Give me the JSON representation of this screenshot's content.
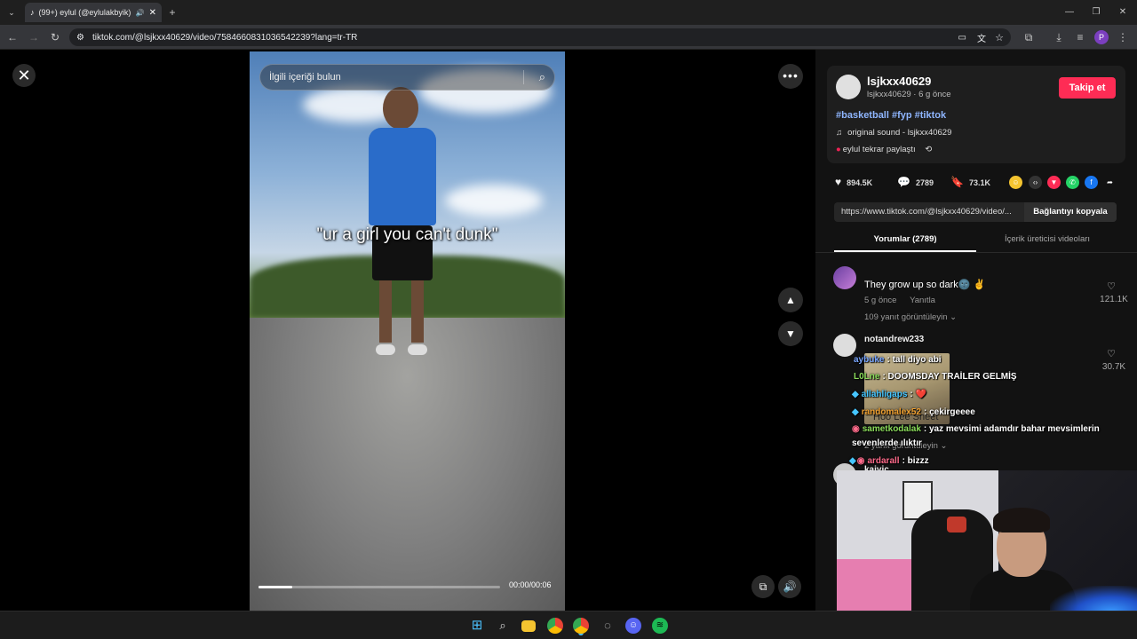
{
  "browser": {
    "tab_title": "(99+) eylul (@eylulakbyik) |",
    "url": "tiktok.com/@lsjkxx40629/video/7584660831036542239?lang=tr-TR"
  },
  "video": {
    "search_placeholder": "İlgili içeriği bulun",
    "caption": "\"ur a girl you can't dunk\"",
    "time": "00:00/00:06",
    "progress": 0.14
  },
  "author": {
    "username": "lsjkxx40629",
    "subline": "lsjkxx40629 · 6 g önce",
    "follow_label": "Takip et",
    "hashtags": "#basketball #fyp #tiktok",
    "sound": "original sound - lsjkxx40629",
    "repost": "eylul tekrar paylaştı"
  },
  "stats": {
    "likes": "894.5K",
    "comments": "2789",
    "saves": "73.1K"
  },
  "share_icons": [
    {
      "name": "embed-icon",
      "color": "#f4c430"
    },
    {
      "name": "code-icon",
      "color": "#333333"
    },
    {
      "name": "send-icon",
      "color": "#fe2c55"
    },
    {
      "name": "whatsapp-icon",
      "color": "#25d366"
    },
    {
      "name": "facebook-icon",
      "color": "#1877f2"
    },
    {
      "name": "share-arrow-icon",
      "color": "#121212"
    }
  ],
  "link": {
    "url": "https://www.tiktok.com/@lsjkxx40629/video/...",
    "copy_label": "Bağlantıyı kopyala"
  },
  "tabs": {
    "comments": "Yorumlar (2789)",
    "creator": "İçerik üreticisi videoları"
  },
  "comments": [
    {
      "text": "They grow up so dark🌚 ✌",
      "time": "5 g önce",
      "reply": "Yanıtla",
      "replies": "109 yanıt görüntüleyin ⌄",
      "likes": "121.1K"
    },
    {
      "name": "notandrew233",
      "replies": "2 yanıt görüntüleyin ⌄",
      "likes": "30.7K",
      "image_text": "Hoo Lee Sheet"
    },
    {
      "name": "kaivic"
    }
  ],
  "chat": [
    {
      "user": "aybuke",
      "msg": ": tall diyo abi",
      "color": "#7aa7ff"
    },
    {
      "user": "L0Lne",
      "msg": ": DOOMSDAY TRAİLER GELMİŞ",
      "color": "#8bdc5b"
    },
    {
      "user": "allahligaps",
      "msg": ": ❤️",
      "color": "#46c6ff"
    },
    {
      "user": "randomalex52",
      "msg": ": çekirgeeee",
      "color": "#f0a030"
    },
    {
      "user": "sametkodalak",
      "msg": ": yaz mevsimi adamdır bahar mevsimlerin",
      "color": "#8bdc5b"
    },
    {
      "user": "",
      "msg": "sevenlerde ılıktır",
      "color": "#ffffff"
    },
    {
      "user": "ardarall",
      "msg": ": bizzz",
      "color": "#ff6b8b"
    }
  ],
  "taskbar": [
    "windows-icon",
    "search-icon",
    "files-icon",
    "chrome-icon",
    "chrome-active-icon",
    "app-icon",
    "discord-icon",
    "spotify-icon"
  ]
}
